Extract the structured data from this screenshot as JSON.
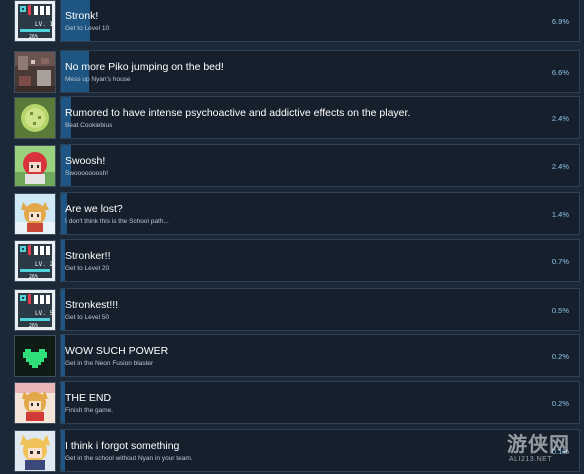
{
  "achievements": [
    {
      "title": "Stronk!",
      "description": "Get to Level 10",
      "percent": "6.9%",
      "progress": 6.9,
      "icon": "level-10-card-icon"
    },
    {
      "title": "No more Piko jumping on the bed!",
      "description": "Mess up Nyan's house",
      "percent": "6.6%",
      "progress": 6.6,
      "icon": "messy-room-icon"
    },
    {
      "title": "Rumored to have intense psychoactive and addictive effects on the player.",
      "description": "Beat Cookiebius",
      "percent": "2.4%",
      "progress": 2.4,
      "icon": "cookie-icon"
    },
    {
      "title": "Swoosh!",
      "description": "Swooooooosh!",
      "percent": "2.4%",
      "progress": 2.4,
      "icon": "red-hair-character-icon"
    },
    {
      "title": "Are we lost?",
      "description": "I don't think this is the School path...",
      "percent": "1.4%",
      "progress": 1.4,
      "icon": "catgirl-sky-icon"
    },
    {
      "title": "Stronker!!",
      "description": "Get to Level 20",
      "percent": "0.7%",
      "progress": 0.7,
      "icon": "level-20-card-icon"
    },
    {
      "title": "Stronkest!!!",
      "description": "Get to Level 50",
      "percent": "0.5%",
      "progress": 0.5,
      "icon": "level-50-card-icon"
    },
    {
      "title": "WOW SUCH POWER",
      "description": "Get in the Neon Fusion blaster",
      "percent": "0.2%",
      "progress": 0.2,
      "icon": "green-heart-icon"
    },
    {
      "title": "THE END",
      "description": "Finish the game.",
      "percent": "0.2%",
      "progress": 0.2,
      "icon": "catgirl-end-icon"
    },
    {
      "title": "I think i forgot something",
      "description": "Get in the school without Nyan in your team.",
      "percent": "0.1%",
      "progress": 0.1,
      "icon": "blonde-catgirl-icon"
    }
  ],
  "watermark": {
    "main": "游侠网",
    "sub": "ALI213.NET"
  },
  "colors": {
    "background": "#1b2838",
    "panel": "#16202d",
    "progress": "#1f5582",
    "percent_text": "#8fc5ea"
  }
}
